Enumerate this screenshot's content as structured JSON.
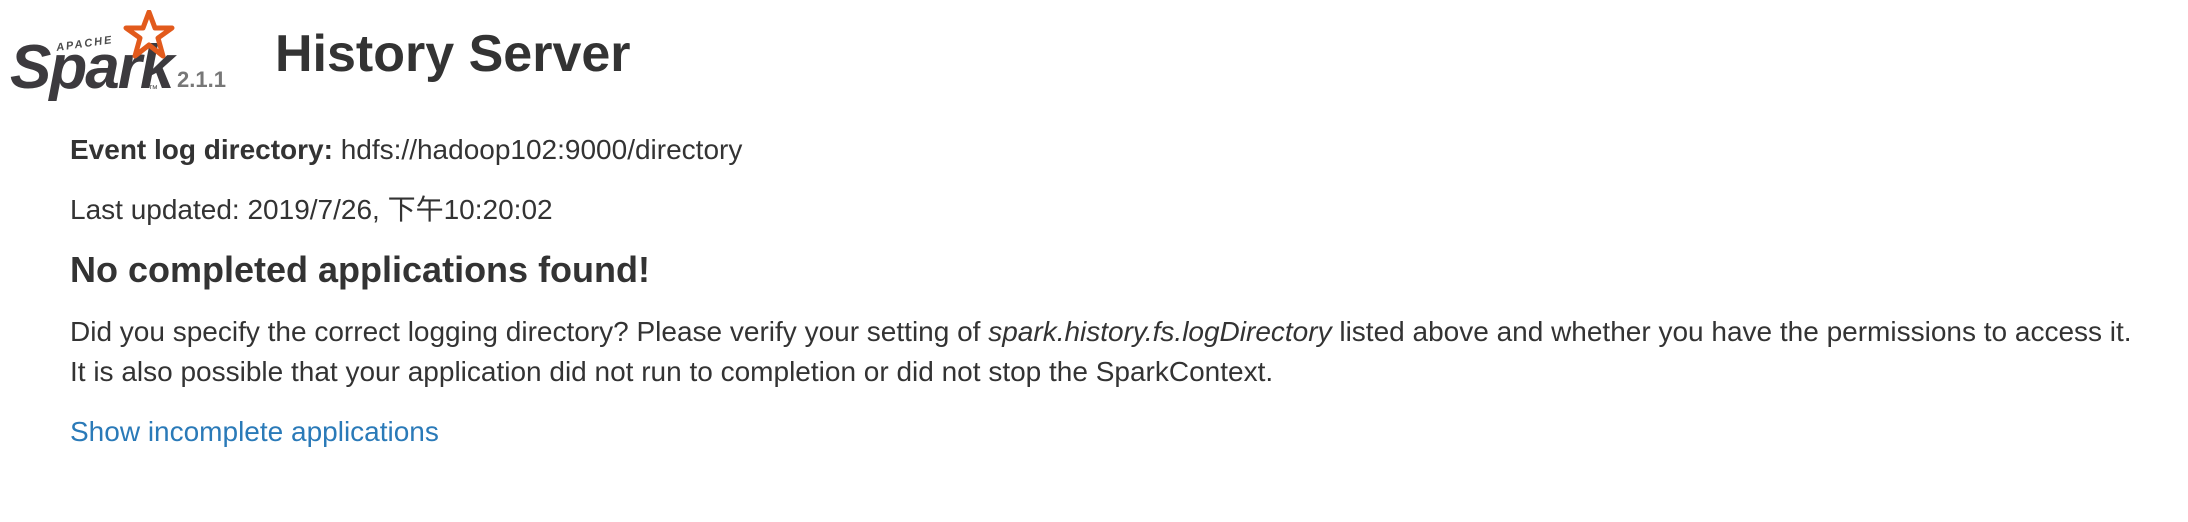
{
  "header": {
    "logo": {
      "apache_text": "APACHE",
      "spark_text": "Spark",
      "trademark": "™",
      "star_color": "#e25a1c"
    },
    "version": "2.1.1",
    "title": "History Server"
  },
  "info": {
    "event_log_label": "Event log directory:",
    "event_log_value": "hdfs://hadoop102:9000/directory",
    "last_updated_label": "Last updated:",
    "last_updated_value": "2019/7/26, 下午10:20:02"
  },
  "message": {
    "heading": "No completed applications found!",
    "line1_before": "Did you specify the correct logging directory? Please verify your setting of ",
    "line1_setting": "spark.history.fs.logDirectory",
    "line1_after": " listed above and whether you have the permissions to access it.",
    "line2": "It is also possible that your application did not run to completion or did not stop the SparkContext."
  },
  "links": {
    "show_incomplete": "Show incomplete applications"
  },
  "colors": {
    "link": "#2a7ab8",
    "text": "#333333",
    "version": "#777777"
  }
}
